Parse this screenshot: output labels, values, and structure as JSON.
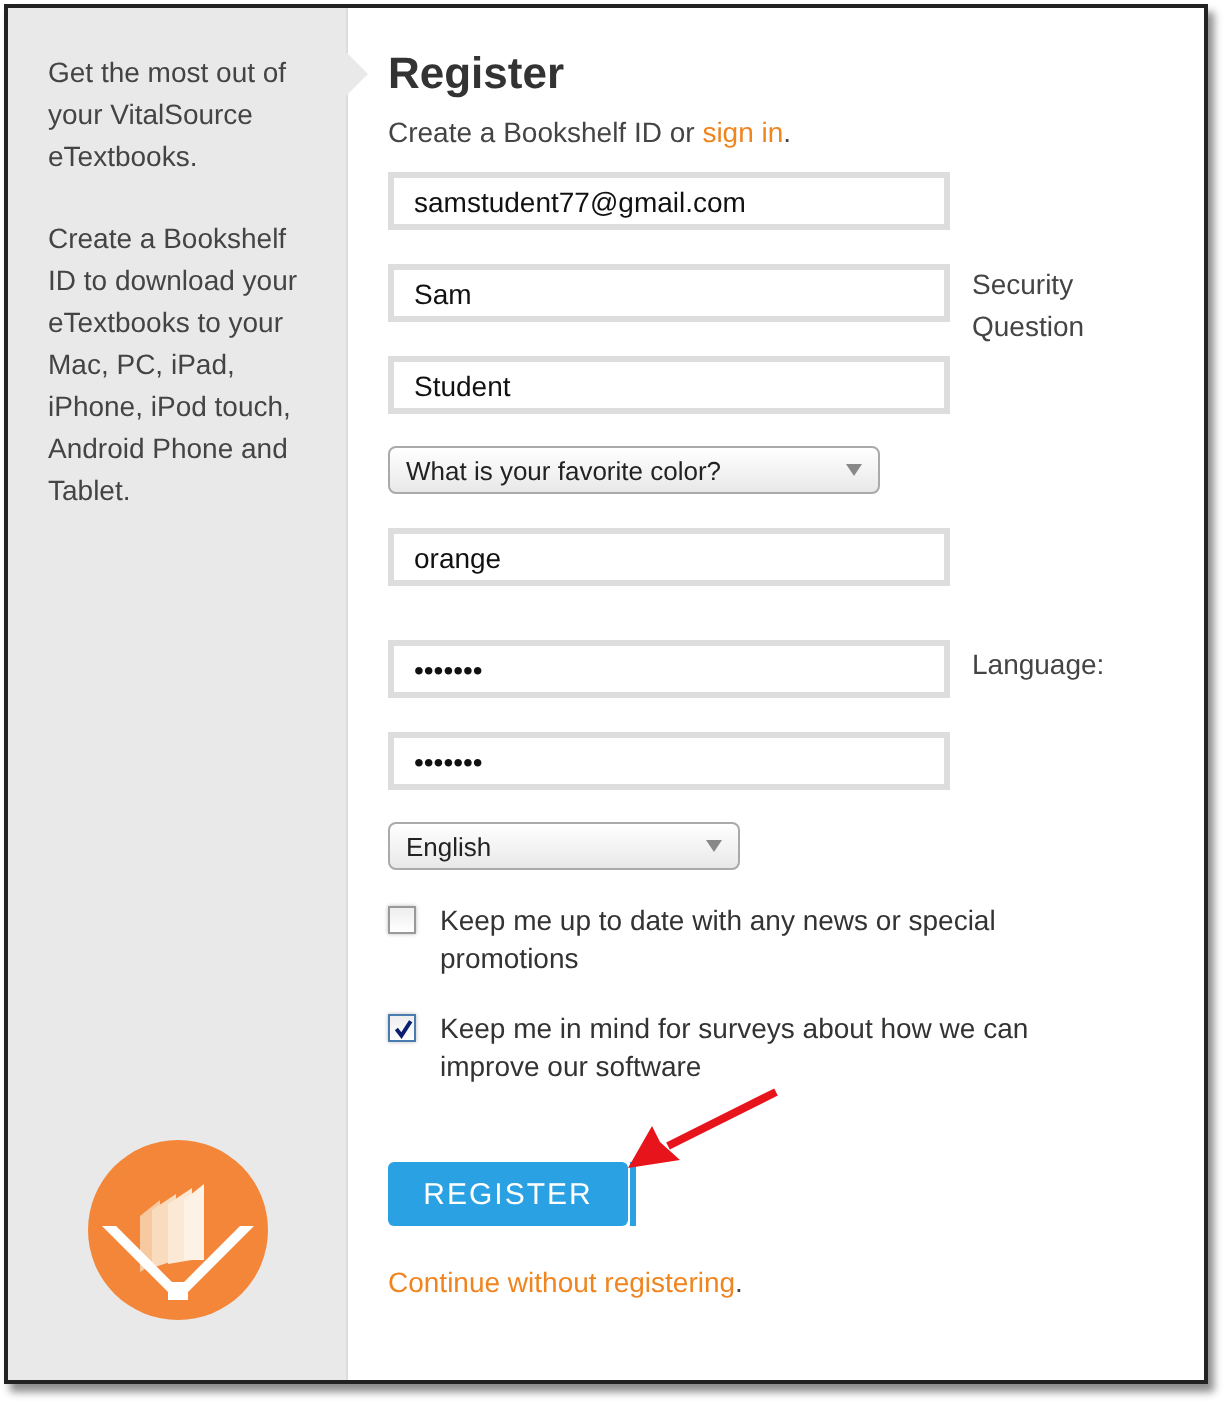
{
  "sidebar": {
    "paragraphs": [
      "Get the most out of your VitalSource eTextbooks.",
      "Create a Bookshelf ID to download your eTextbooks to your Mac, PC, iPad, iPhone, iPod touch, Android Phone and Tablet."
    ]
  },
  "form": {
    "title": "Register",
    "intro": "Create a Bookshelf ID or",
    "intro_link": "sign in",
    "intro_end": ".",
    "fields": [
      {
        "kind": "text",
        "value": "samstudent77@gmail.com"
      },
      {
        "kind": "text",
        "value": "Sam"
      },
      {
        "kind": "text",
        "value": "Student"
      },
      {
        "kind": "select",
        "value": "What is your favorite color?"
      },
      {
        "kind": "text",
        "value": "orange"
      },
      {
        "kind": "text",
        "value": "•••••••"
      },
      {
        "kind": "text",
        "value": "•••••••"
      },
      {
        "kind": "select",
        "value": "English"
      }
    ],
    "side_labels": [
      "Security Question",
      "Language:"
    ],
    "checkboxes": [
      {
        "label": "Keep me up to date with any news or special promotions",
        "checked": false
      },
      {
        "label": "Keep me in mind for surveys about how we can improve our software",
        "checked": true
      }
    ],
    "button": "REGISTER",
    "skip_link": "Continue without registering",
    "skip_end": "."
  }
}
